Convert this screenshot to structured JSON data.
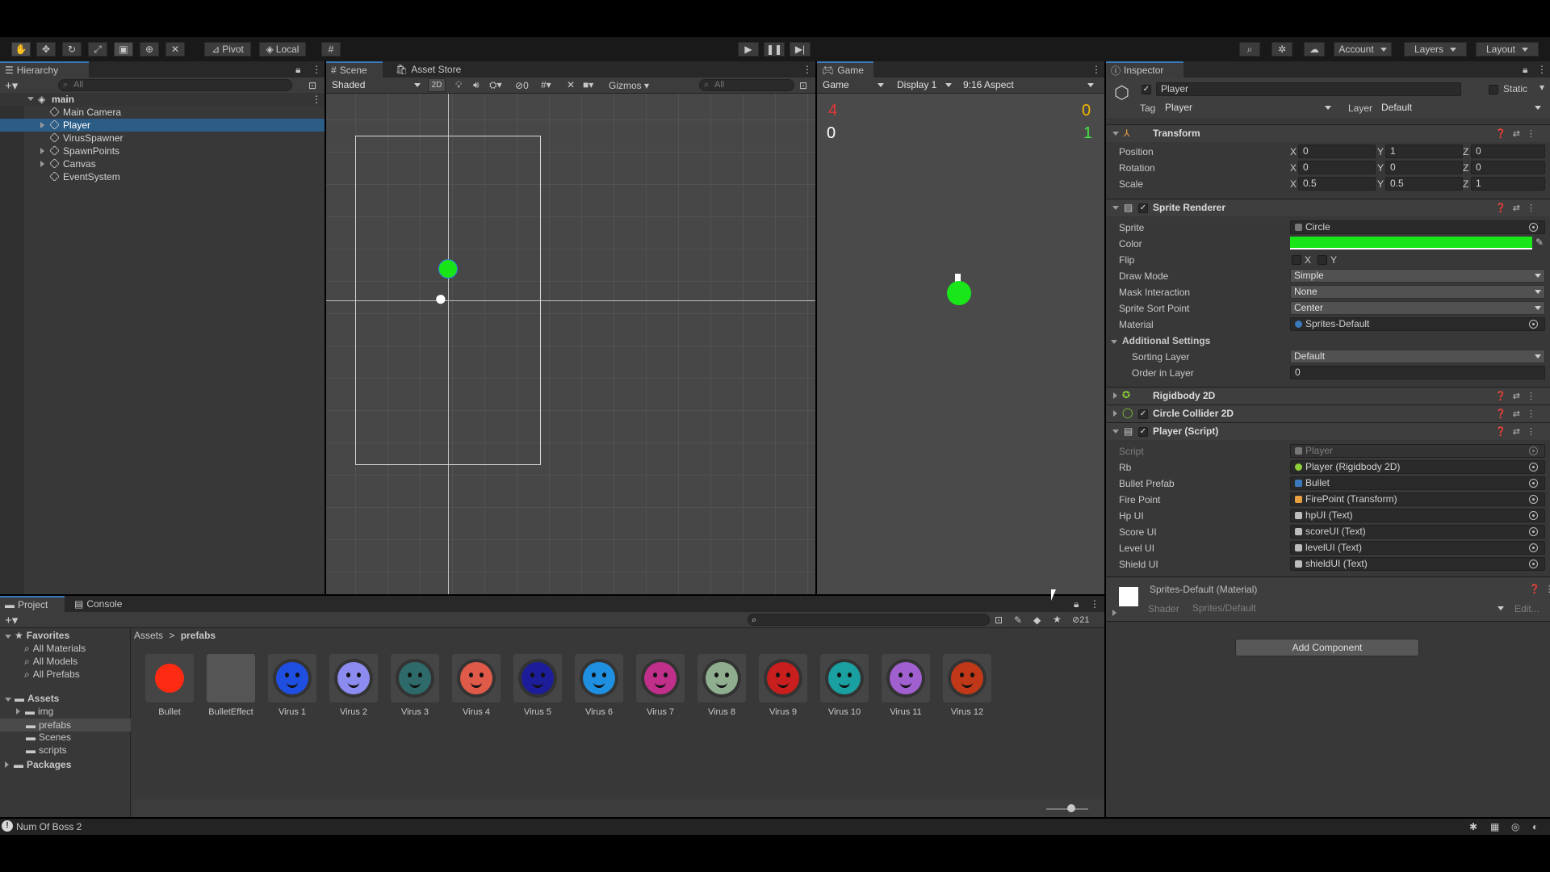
{
  "toolbar": {
    "pivot": "Pivot",
    "local": "Local",
    "account": "Account",
    "layers": "Layers",
    "layout": "Layout"
  },
  "hierarchy": {
    "tab": "Hierarchy",
    "search_placeholder": "All",
    "scene": "main",
    "items": [
      "Main Camera",
      "Player",
      "VirusSpawner",
      "SpawnPoints",
      "Canvas",
      "EventSystem"
    ]
  },
  "scene_view": {
    "tabs": [
      "Scene",
      "Asset Store"
    ],
    "shading": "Shaded",
    "mode_2d": "2D",
    "hidden_count": "0",
    "gizmos": "Gizmos",
    "search_placeholder": "All"
  },
  "game_view": {
    "tab": "Game",
    "mode": "Game",
    "display": "Display 1",
    "aspect": "9:16 Aspect",
    "hud": {
      "top_left": "4",
      "top_right": "0",
      "left": "0",
      "right": "1"
    },
    "colors": {
      "top_left": "#e53935",
      "top_right": "#f5b800",
      "left": "#ffffff",
      "right": "#45e645"
    }
  },
  "inspector": {
    "tab": "Inspector",
    "object_name": "Player",
    "static_label": "Static",
    "tag_label": "Tag",
    "tag": "Player",
    "layer_label": "Layer",
    "layer": "Default",
    "transform": {
      "title": "Transform",
      "position_label": "Position",
      "rotation_label": "Rotation",
      "scale_label": "Scale",
      "position": [
        "0",
        "1",
        "0"
      ],
      "rotation": [
        "0",
        "0",
        "0"
      ],
      "scale": [
        "0.5",
        "0.5",
        "1"
      ]
    },
    "sprite_renderer": {
      "title": "Sprite Renderer",
      "sprite_label": "Sprite",
      "sprite": "Circle",
      "color_label": "Color",
      "color": "#19e619",
      "flip_label": "Flip",
      "flip_x": "X",
      "flip_y": "Y",
      "draw_mode_label": "Draw Mode",
      "draw_mode": "Simple",
      "mask_label": "Mask Interaction",
      "mask": "None",
      "sort_point_label": "Sprite Sort Point",
      "sort_point": "Center",
      "material_label": "Material",
      "material": "Sprites-Default",
      "additional": "Additional Settings",
      "sorting_layer_label": "Sorting Layer",
      "sorting_layer": "Default",
      "order_label": "Order in Layer",
      "order": "0"
    },
    "rigidbody": {
      "title": "Rigidbody 2D"
    },
    "collider": {
      "title": "Circle Collider 2D"
    },
    "player_script": {
      "title": "Player (Script)",
      "fields": [
        {
          "label": "Script",
          "value": "Player"
        },
        {
          "label": "Rb",
          "value": "Player (Rigidbody 2D)"
        },
        {
          "label": "Bullet Prefab",
          "value": "Bullet"
        },
        {
          "label": "Fire Point",
          "value": "FirePoint (Transform)"
        },
        {
          "label": "Hp UI",
          "value": "hpUI (Text)"
        },
        {
          "label": "Score UI",
          "value": "scoreUI (Text)"
        },
        {
          "label": "Level UI",
          "value": "levelUI (Text)"
        },
        {
          "label": "Shield UI",
          "value": "shieldUI (Text)"
        }
      ]
    },
    "material": {
      "title": "Sprites-Default (Material)",
      "shader_label": "Shader",
      "shader": "Sprites/Default",
      "edit": "Edit..."
    },
    "add_component": "Add Component"
  },
  "project": {
    "tabs": [
      "Project",
      "Console"
    ],
    "hidden_count": "21",
    "favorites": {
      "title": "Favorites",
      "items": [
        "All Materials",
        "All Models",
        "All Prefabs"
      ]
    },
    "assets": {
      "title": "Assets",
      "items": [
        "img",
        "prefabs",
        "Scenes",
        "scripts"
      ]
    },
    "packages": "Packages",
    "breadcrumb": [
      "Assets",
      "prefabs"
    ],
    "files": [
      {
        "name": "Bullet",
        "color": "#ff2a12"
      },
      {
        "name": "BulletEffect",
        "color": "#555555"
      },
      {
        "name": "Virus 1",
        "color": "#1f4fe0"
      },
      {
        "name": "Virus 2",
        "color": "#8c8cf0"
      },
      {
        "name": "Virus 3",
        "color": "#2f6a6a"
      },
      {
        "name": "Virus 4",
        "color": "#e05a4a"
      },
      {
        "name": "Virus 5",
        "color": "#1d1d9a"
      },
      {
        "name": "Virus 6",
        "color": "#1f8fe0"
      },
      {
        "name": "Virus 7",
        "color": "#c0308a"
      },
      {
        "name": "Virus 8",
        "color": "#8fae8f"
      },
      {
        "name": "Virus 9",
        "color": "#c81e1e"
      },
      {
        "name": "Virus 10",
        "color": "#1aa0a0"
      },
      {
        "name": "Virus 11",
        "color": "#a060d0"
      },
      {
        "name": "Virus 12",
        "color": "#c03818"
      }
    ]
  },
  "status": {
    "message": "Num Of Boss 2"
  }
}
